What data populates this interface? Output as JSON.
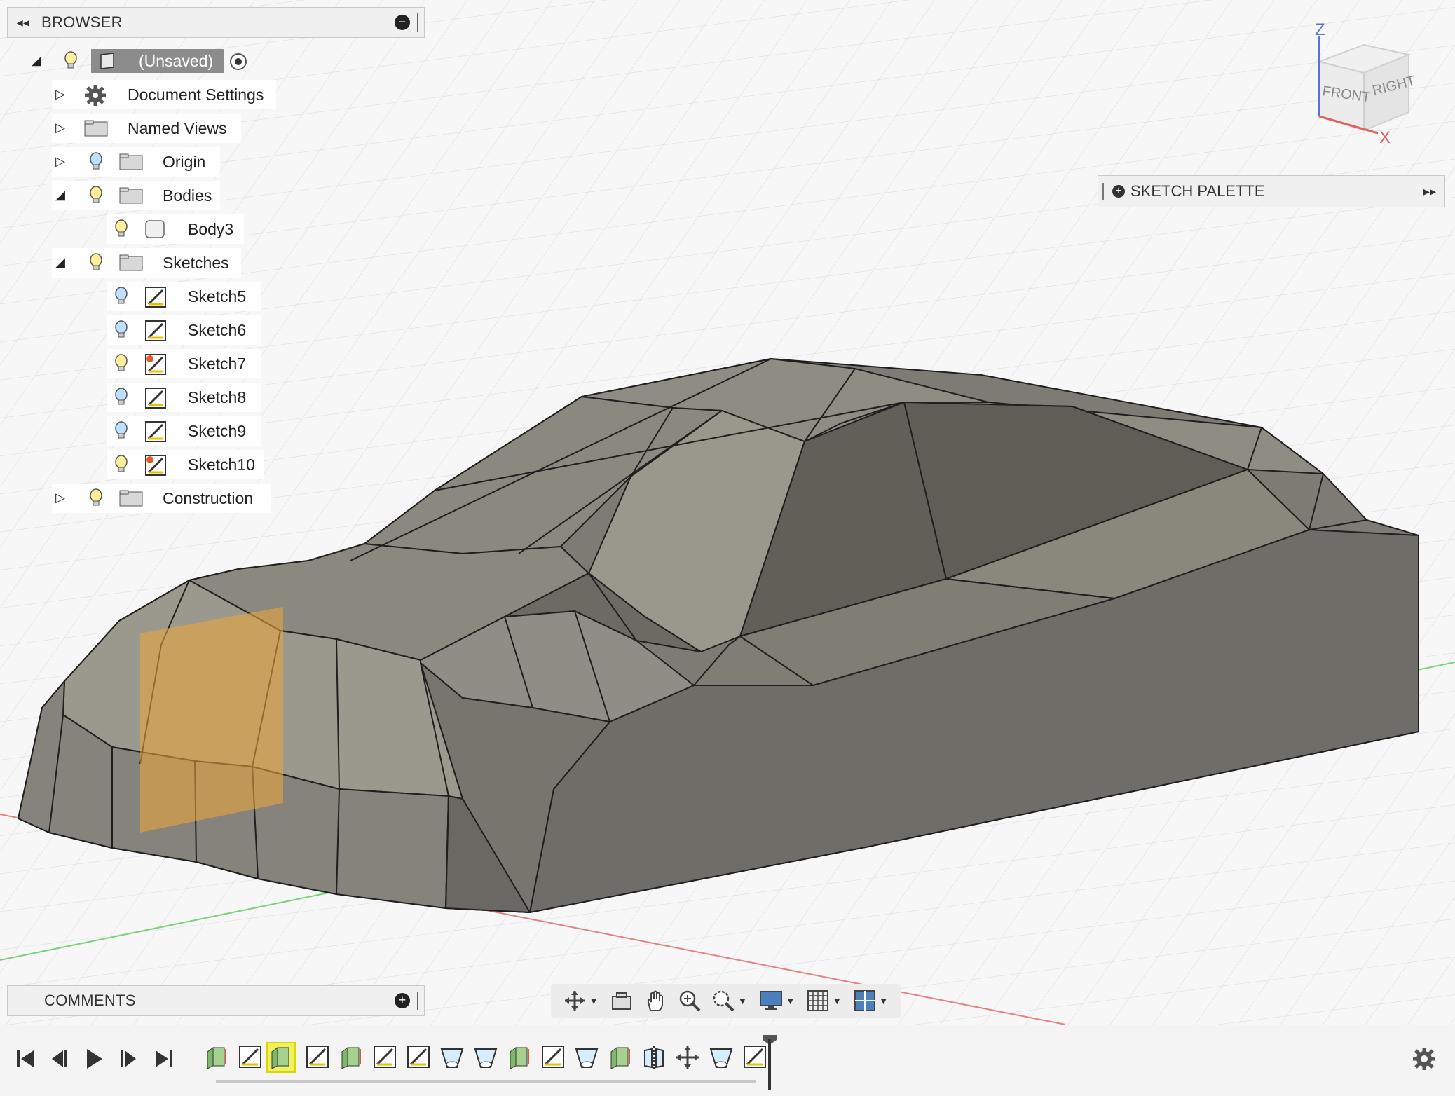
{
  "browser": {
    "title": "BROWSER",
    "collapse_glyph": "◂◂",
    "items": [
      {
        "label": "(Unsaved)",
        "icon": "component-icon",
        "expanded": true
      },
      {
        "label": "Document Settings",
        "icon": "gear-icon"
      },
      {
        "label": "Named Views",
        "icon": "folder-icon"
      },
      {
        "label": "Origin",
        "icon": "folder-icon"
      },
      {
        "label": "Bodies",
        "icon": "folder-icon",
        "expanded": true
      },
      {
        "label": "Body3",
        "icon": "body-icon"
      },
      {
        "label": "Sketches",
        "icon": "folder-icon",
        "expanded": true
      },
      {
        "label": "Sketch5",
        "icon": "sketch-icon"
      },
      {
        "label": "Sketch6",
        "icon": "sketch-icon"
      },
      {
        "label": "Sketch7",
        "icon": "sketch-warning-icon"
      },
      {
        "label": "Sketch8",
        "icon": "sketch-icon"
      },
      {
        "label": "Sketch9",
        "icon": "sketch-icon"
      },
      {
        "label": "Sketch10",
        "icon": "sketch-warning-icon"
      },
      {
        "label": "Construction",
        "icon": "folder-icon"
      }
    ]
  },
  "viewcube": {
    "front": "FRONT",
    "right": "RIGHT",
    "z": "Z",
    "x": "X"
  },
  "sketch_palette": {
    "title": "SKETCH PALETTE"
  },
  "comments": {
    "title": "COMMENTS"
  },
  "colors": {
    "body_gray": "#7a786f",
    "highlight_orange": "#f0a83a",
    "timeline_active": "#f0f060",
    "axis_red": "#e06060",
    "axis_green": "#60c060"
  },
  "timeline": {
    "features": [
      "extrude",
      "sketch",
      "extrude",
      "sketch",
      "extrude",
      "sketch",
      "sketch",
      "loft",
      "loft",
      "extrude",
      "sketch",
      "loft",
      "extrude",
      "mirror",
      "move",
      "loft",
      "sketch"
    ],
    "active_index": 2
  }
}
